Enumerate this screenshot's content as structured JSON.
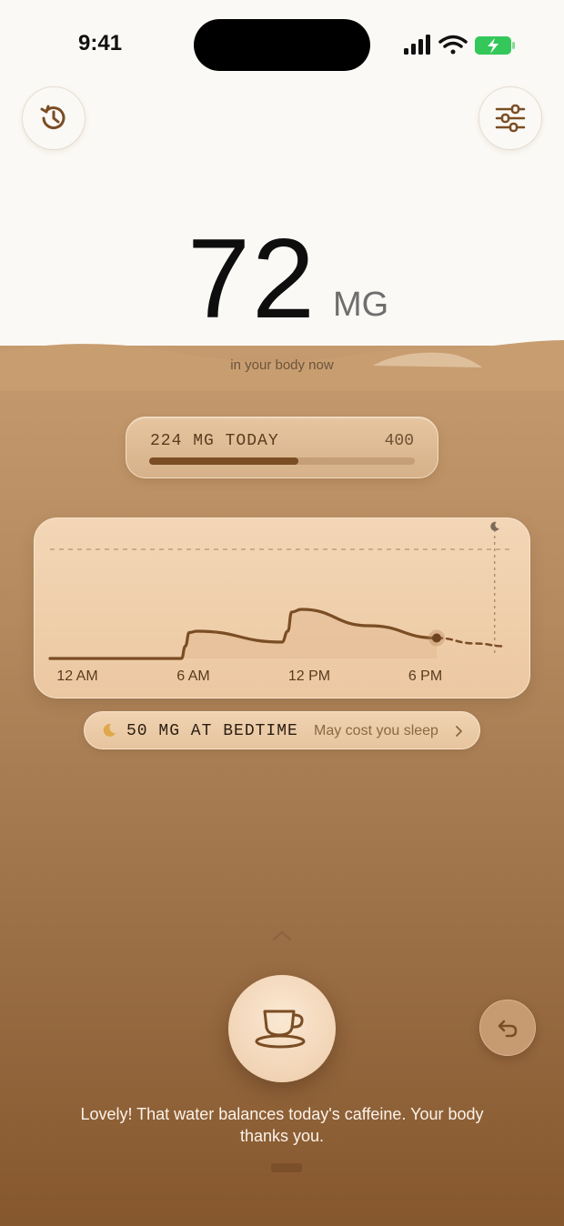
{
  "status_bar": {
    "time": "9:41"
  },
  "reading": {
    "value": "72",
    "unit": "MG",
    "subtitle": "in your body now"
  },
  "today": {
    "label": "224 MG TODAY",
    "limit_label": "400",
    "consumed_mg": 224,
    "limit_mg": 400
  },
  "bedtime": {
    "label": "50 MG AT BEDTIME",
    "separator": "·",
    "note": "May cost you sleep"
  },
  "message": "Lovely! That water balances today's caffeine. Your body thanks you.",
  "colors": {
    "accent": "#7a4d24",
    "card": "#f0d1ae",
    "background_top": "#fbf9f5",
    "background_bottom": "#86572d"
  },
  "icons": {
    "history": "history-icon",
    "settings": "sliders-icon",
    "bedtime": "moon-icon",
    "cup": "coffee-cup-icon",
    "undo": "undo-icon",
    "expand": "chevron-up-icon"
  },
  "chart_data": {
    "type": "line",
    "x_tick_labels": [
      "12 AM",
      "6 AM",
      "12 PM",
      "6 PM"
    ],
    "x_unit": "hour of day",
    "y_unit": "mg",
    "xlim": [
      0,
      24
    ],
    "ylim": [
      0,
      400
    ],
    "limit_line": 400,
    "bedtime_hour": 23,
    "current_hour": 20,
    "series": [
      {
        "style": "solid",
        "x": [
          0,
          6.8,
          7.0,
          7.2,
          7.6,
          12.0,
          12.3,
          12.5,
          13.0,
          16.5,
          20.0
        ],
        "y": [
          0,
          0,
          45,
          95,
          100,
          60,
          100,
          170,
          180,
          120,
          75
        ]
      },
      {
        "style": "dashed",
        "x": [
          20.0,
          22.0,
          23.5
        ],
        "y": [
          75,
          55,
          45
        ]
      }
    ]
  }
}
